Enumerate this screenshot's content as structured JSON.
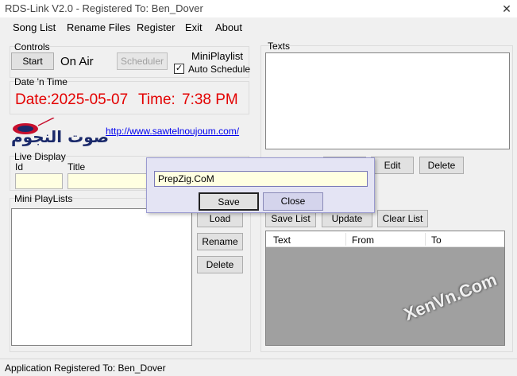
{
  "window": {
    "title": "RDS-Link V2.0 - Registered To: Ben_Dover"
  },
  "menu": [
    "Song List",
    "Rename Files",
    "Register",
    "Exit",
    "About"
  ],
  "controls": {
    "title": "Controls",
    "start_label": "Start",
    "on_air": "On Air",
    "scheduler_label": "Scheduler",
    "miniplaylist": "MiniPlaylist",
    "auto_schedule_label": "Auto Schedule",
    "auto_schedule_checked": true
  },
  "datetime": {
    "title": "Date 'n Time",
    "date_label": "Date:",
    "date_value": "2025-05-07",
    "time_label": "Time:",
    "time_value": "7:38 PM"
  },
  "logo": {
    "text": "صوت النجوم"
  },
  "link": "http://www.sawtelnoujoum.com/",
  "live_display": {
    "title": "Live Display",
    "id_label": "Id",
    "title_label": "Title"
  },
  "mini_playlists": {
    "title": "Mini PlayLists",
    "load_label": "Load",
    "rename_label": "Rename",
    "delete_label": "Delete"
  },
  "texts": {
    "title": "Texts",
    "edit_label": "Edit",
    "delete_label": "Delete",
    "save_list_label": "Save List",
    "update_label": "Update",
    "clear_list_label": "Clear List",
    "columns": [
      "Text",
      "From",
      "To"
    ]
  },
  "dialog": {
    "input_value": "PrepZig.CoM",
    "save_label": "Save",
    "close_label": "Close"
  },
  "status": {
    "text": "Application Registered To: Ben_Dover"
  },
  "watermark": "XenVn.Com"
}
